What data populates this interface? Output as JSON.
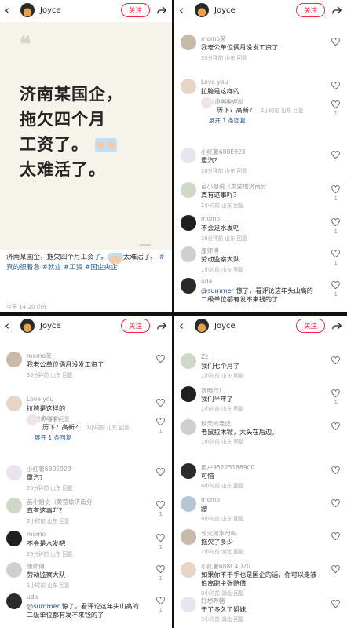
{
  "header": {
    "username": "Joyce",
    "follow_label": "关注",
    "back_icon": "chevron-left-icon",
    "share_icon": "share-icon"
  },
  "post": {
    "lines": [
      "济南某国企，",
      "拖欠四个月",
      "工资了。",
      "太难活了。"
    ],
    "caption": "济南某国企，拖欠四个月工资了。",
    "caption_tail": "太难活了。",
    "tags": [
      "#真的很着急",
      "#就业",
      "#工资",
      "#国企央企"
    ],
    "meta": "今天 14:20 山东"
  },
  "comments_a": [
    {
      "name": "momo茉",
      "text": "我老公单位俩月没发工资了",
      "time": "33分钟前 山东 回复",
      "likes": ""
    },
    {
      "name": "Love you",
      "text": "拉胯是这样的",
      "time": "1小时前 山东 回复",
      "likes": "",
      "sub": {
        "name": "happy",
        "text": "历下？高新？",
        "time": "1小时前 山东 回复",
        "likes": "1"
      },
      "expand": "展开 1 条回复"
    },
    {
      "name": "小红薯680E923",
      "text": "重汽？",
      "time": "26分钟前 山东 回复",
      "likes": ""
    },
    {
      "name": "苗小姐说（黄莹瑜济南分",
      "text": "真有这事吖？",
      "time": "2小时前 山东 回复",
      "likes": "1"
    },
    {
      "name": "momo",
      "text": "不会是水发吧",
      "time": "29分钟前 山东 回复",
      "likes": "1"
    },
    {
      "name": "康师傅",
      "text": "劳动监察大队",
      "time": "1小时前 山东 回复",
      "likes": "1"
    },
    {
      "name": "uda",
      "mention": "@summer",
      "text": " 惊了，看评论这年头山高的二级单位都有发不来钱的了",
      "time": "",
      "likes": "1"
    }
  ],
  "comments_b": [
    {
      "name": "Zz",
      "text": "我们七个月了",
      "time": "1小时前 山东 回复",
      "likes": ""
    },
    {
      "name": "我砸行！",
      "text": "我们半年了",
      "time": "1小时前 山东 回复",
      "likes": "1"
    },
    {
      "name": "秋天的老虎",
      "text": "老鼠拉木锨，大头在后边。",
      "time": "1小时前 山东 回复",
      "likes": ""
    },
    {
      "name": "用户95225186900",
      "text": "可恼",
      "time": "8小时前 山东 回复",
      "likes": ""
    },
    {
      "name": "momo",
      "text": "蹭",
      "time": "8小时前 山东 回复",
      "likes": ""
    },
    {
      "name": "今天抓水母吗",
      "text": "拖欠了多少",
      "time": "2小时前 湖北 回复",
      "likes": ""
    },
    {
      "name": "小红薯688C4D20",
      "text": "如果你不干手也是国企的话，你可以走被追离职主张赔偿",
      "time": "8小时前 湖北 回复",
      "likes": ""
    },
    {
      "name": "好想养猪",
      "text": "干了多久了姐妹",
      "time": "3小时前 湖北 回复",
      "likes": ""
    }
  ],
  "colors": {
    "accent": "#ff2442",
    "link": "#2a5b96",
    "poster_bg": "#f6f3ea"
  }
}
